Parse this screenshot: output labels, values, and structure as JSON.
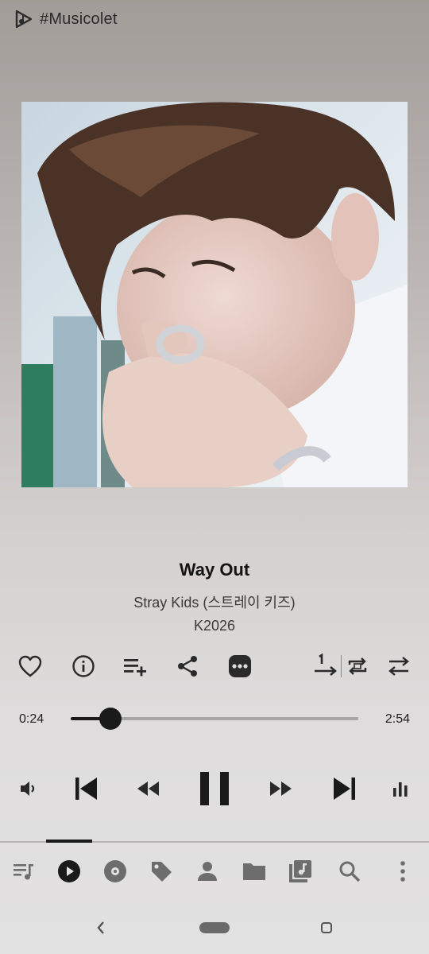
{
  "app": {
    "title": "#Musicolet"
  },
  "track": {
    "title": "Way Out",
    "artist": "Stray Kids (스트레이 키즈)",
    "album": "K2026"
  },
  "playback": {
    "elapsed": "0:24",
    "duration": "2:54",
    "progress_fraction": 0.138,
    "state": "playing"
  },
  "action_row": {
    "icons": [
      "heart-icon",
      "info-icon",
      "add-to-queue-icon",
      "share-icon",
      "more-options-icon",
      "repeat-one-icon",
      "repeat-queue-icon",
      "shuffle-icon"
    ]
  },
  "control_row": {
    "icons": [
      "volume-icon",
      "skip-previous-icon",
      "rewind-icon",
      "pause-icon",
      "fast-forward-icon",
      "skip-next-icon",
      "equalizer-icon"
    ]
  },
  "bottom_tabs": {
    "active_index": 1,
    "items": [
      "queue-icon",
      "now-playing-icon",
      "albums-icon",
      "tags-icon",
      "artists-icon",
      "folders-icon",
      "playlists-icon",
      "search-icon",
      "overflow-menu-icon"
    ]
  },
  "colors": {
    "icon": "#2a2a2a",
    "tab_icon": "#6d6d6d",
    "accent": "#1a1a1a"
  }
}
